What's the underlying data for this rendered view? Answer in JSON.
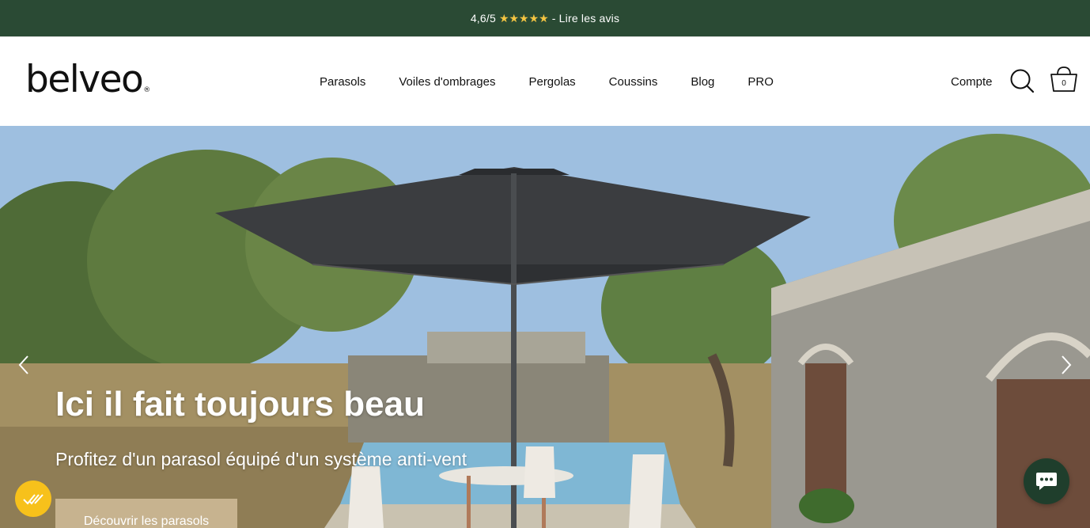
{
  "announcement": {
    "rating": "4,6/5",
    "stars": "★★★★★",
    "link_text": "- Lire les avis"
  },
  "header": {
    "logo_text": "belveo",
    "logo_mark": "®",
    "nav": [
      {
        "label": "Parasols"
      },
      {
        "label": "Voiles d'ombrages"
      },
      {
        "label": "Pergolas"
      },
      {
        "label": "Coussins"
      },
      {
        "label": "Blog"
      },
      {
        "label": "PRO"
      }
    ],
    "account_label": "Compte",
    "cart_count": "0"
  },
  "hero": {
    "title": "Ici il fait toujours beau",
    "subtitle": "Profitez d'un parasol équipé d'un système anti-vent",
    "cta_label": "Découvrir les parasols"
  },
  "icons": {
    "search": "search-icon",
    "cart": "cart-icon",
    "prev": "chevron-left-icon",
    "next": "chevron-right-icon",
    "badge": "checkmarks-badge-icon",
    "chat": "chat-bubble-icon"
  },
  "colors": {
    "topbar_bg": "#2a4a34",
    "stars": "#f4c542",
    "cta_bg": "#c7b38f",
    "badge_bg": "#f7c11b",
    "chat_bg": "#1f3e2c"
  }
}
